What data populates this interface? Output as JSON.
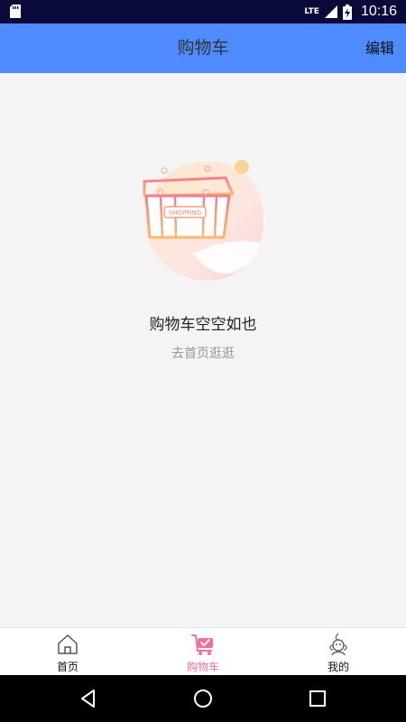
{
  "status_bar": {
    "network": "LTE",
    "time": "10:16",
    "icons": [
      "sd-card-icon",
      "signal-icon",
      "battery-charging-icon"
    ]
  },
  "header": {
    "title": "购物车",
    "edit_label": "编辑",
    "background": "#4d8bff"
  },
  "empty_state": {
    "illustration": "shopping-basket-icon",
    "illustration_text": "SHOPPING",
    "title": "购物车空空如也",
    "link": "去首页逛逛"
  },
  "tabs": [
    {
      "label": "首页",
      "icon": "home-icon",
      "active": false
    },
    {
      "label": "购物车",
      "icon": "cart-icon",
      "active": true
    },
    {
      "label": "我的",
      "icon": "profile-icon",
      "active": false
    }
  ],
  "colors": {
    "accent_pink": "#f06ea0",
    "status_bar": "#0a0a3a"
  },
  "nav_bar": {
    "icons": [
      "back-icon",
      "home-circle-icon",
      "recents-icon"
    ]
  }
}
